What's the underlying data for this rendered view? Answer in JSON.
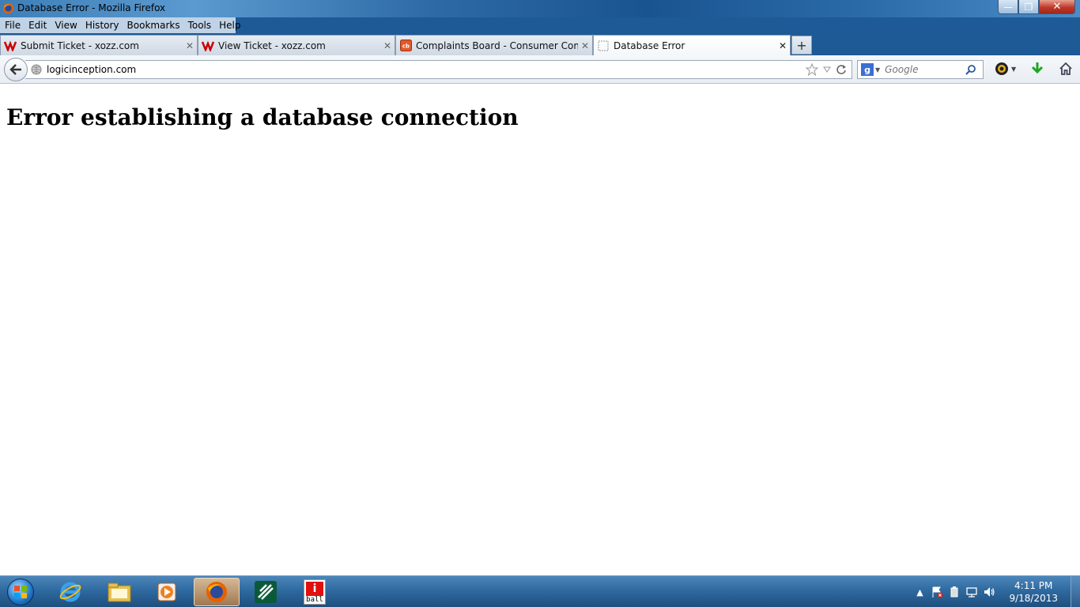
{
  "window": {
    "title": "Database Error - Mozilla Firefox",
    "controls": {
      "minimize": "—",
      "restore": "❐",
      "close": "✕"
    }
  },
  "menu": [
    "File",
    "Edit",
    "View",
    "History",
    "Bookmarks",
    "Tools",
    "Help"
  ],
  "tabs": [
    {
      "label": "Submit Ticket - xozz.com",
      "favicon": "xozz-logo-icon",
      "active": false
    },
    {
      "label": "View Ticket - xozz.com",
      "favicon": "xozz-logo-icon",
      "active": false
    },
    {
      "label": "Complaints Board - Consumer Comp...",
      "favicon": "complaints-board-icon",
      "active": false
    },
    {
      "label": "Database Error",
      "favicon": "blank-page-icon",
      "active": true
    }
  ],
  "navbar": {
    "url": "logicinception.com",
    "search_placeholder": "Google"
  },
  "page": {
    "heading": "Error establishing a database connection"
  },
  "taskbar": {
    "apps": [
      "internet-explorer-icon",
      "file-explorer-icon",
      "media-player-icon",
      "firefox-icon",
      "app-green-icon",
      "iball-icon"
    ],
    "iball_label": "ball",
    "clock_time": "4:11 PM",
    "clock_date": "9/18/2013"
  },
  "colors": {
    "taskbar": "#2f6aa0",
    "titlebar": "#2d6aa6",
    "close_button": "#c0392b"
  }
}
